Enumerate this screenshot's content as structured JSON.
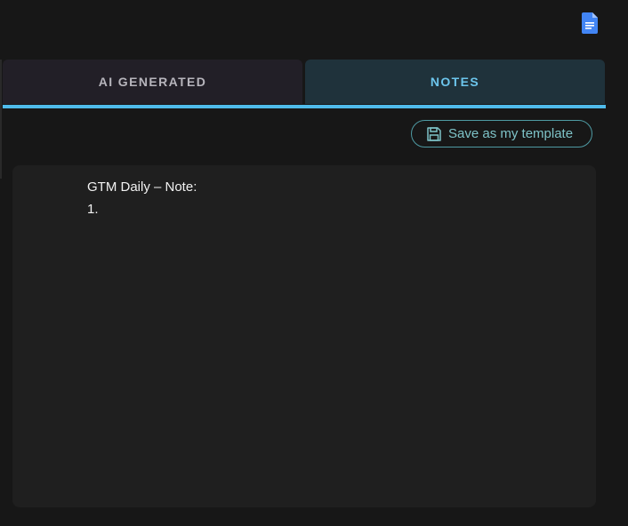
{
  "header": {
    "doc_icon": "google-docs-icon"
  },
  "tabs": [
    {
      "label": "AI GENERATED",
      "active": false
    },
    {
      "label": "NOTES",
      "active": true
    }
  ],
  "toolbar": {
    "save_label": "Save as my template",
    "save_icon": "floppy-disk-icon"
  },
  "editor": {
    "lines": [
      "GTM Daily – Note:",
      "1."
    ]
  },
  "colors": {
    "background": "#171717",
    "editor_bg": "#1f1f1f",
    "accent": "#4fbbeb",
    "active_tab_bg": "#1f323b",
    "inactive_tab_bg": "#221f27",
    "save_button_border": "#4e9aa3",
    "doc_icon_blue": "#4285f4"
  }
}
